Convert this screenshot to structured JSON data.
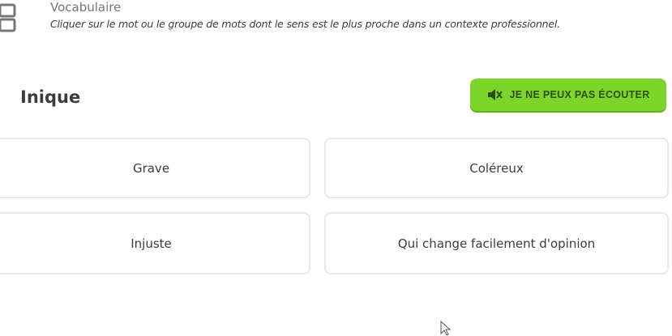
{
  "header": {
    "section_title": "Vocabulaire",
    "instruction": "Cliquer sur le mot ou le groupe de mots dont le sens est le plus proche dans un contexte professionnel.",
    "icon": "chart-icon"
  },
  "question": {
    "word": "Inique"
  },
  "cant_listen": {
    "label": "Je ne peux pas écouter",
    "icon": "muted-speaker-icon",
    "color": "#7cd62a"
  },
  "options": [
    {
      "label": "Grave"
    },
    {
      "label": "Coléreux"
    },
    {
      "label": "Injuste"
    },
    {
      "label": "Qui change facilement d'opinion"
    }
  ],
  "cursor_icon": "mouse-cursor-icon"
}
